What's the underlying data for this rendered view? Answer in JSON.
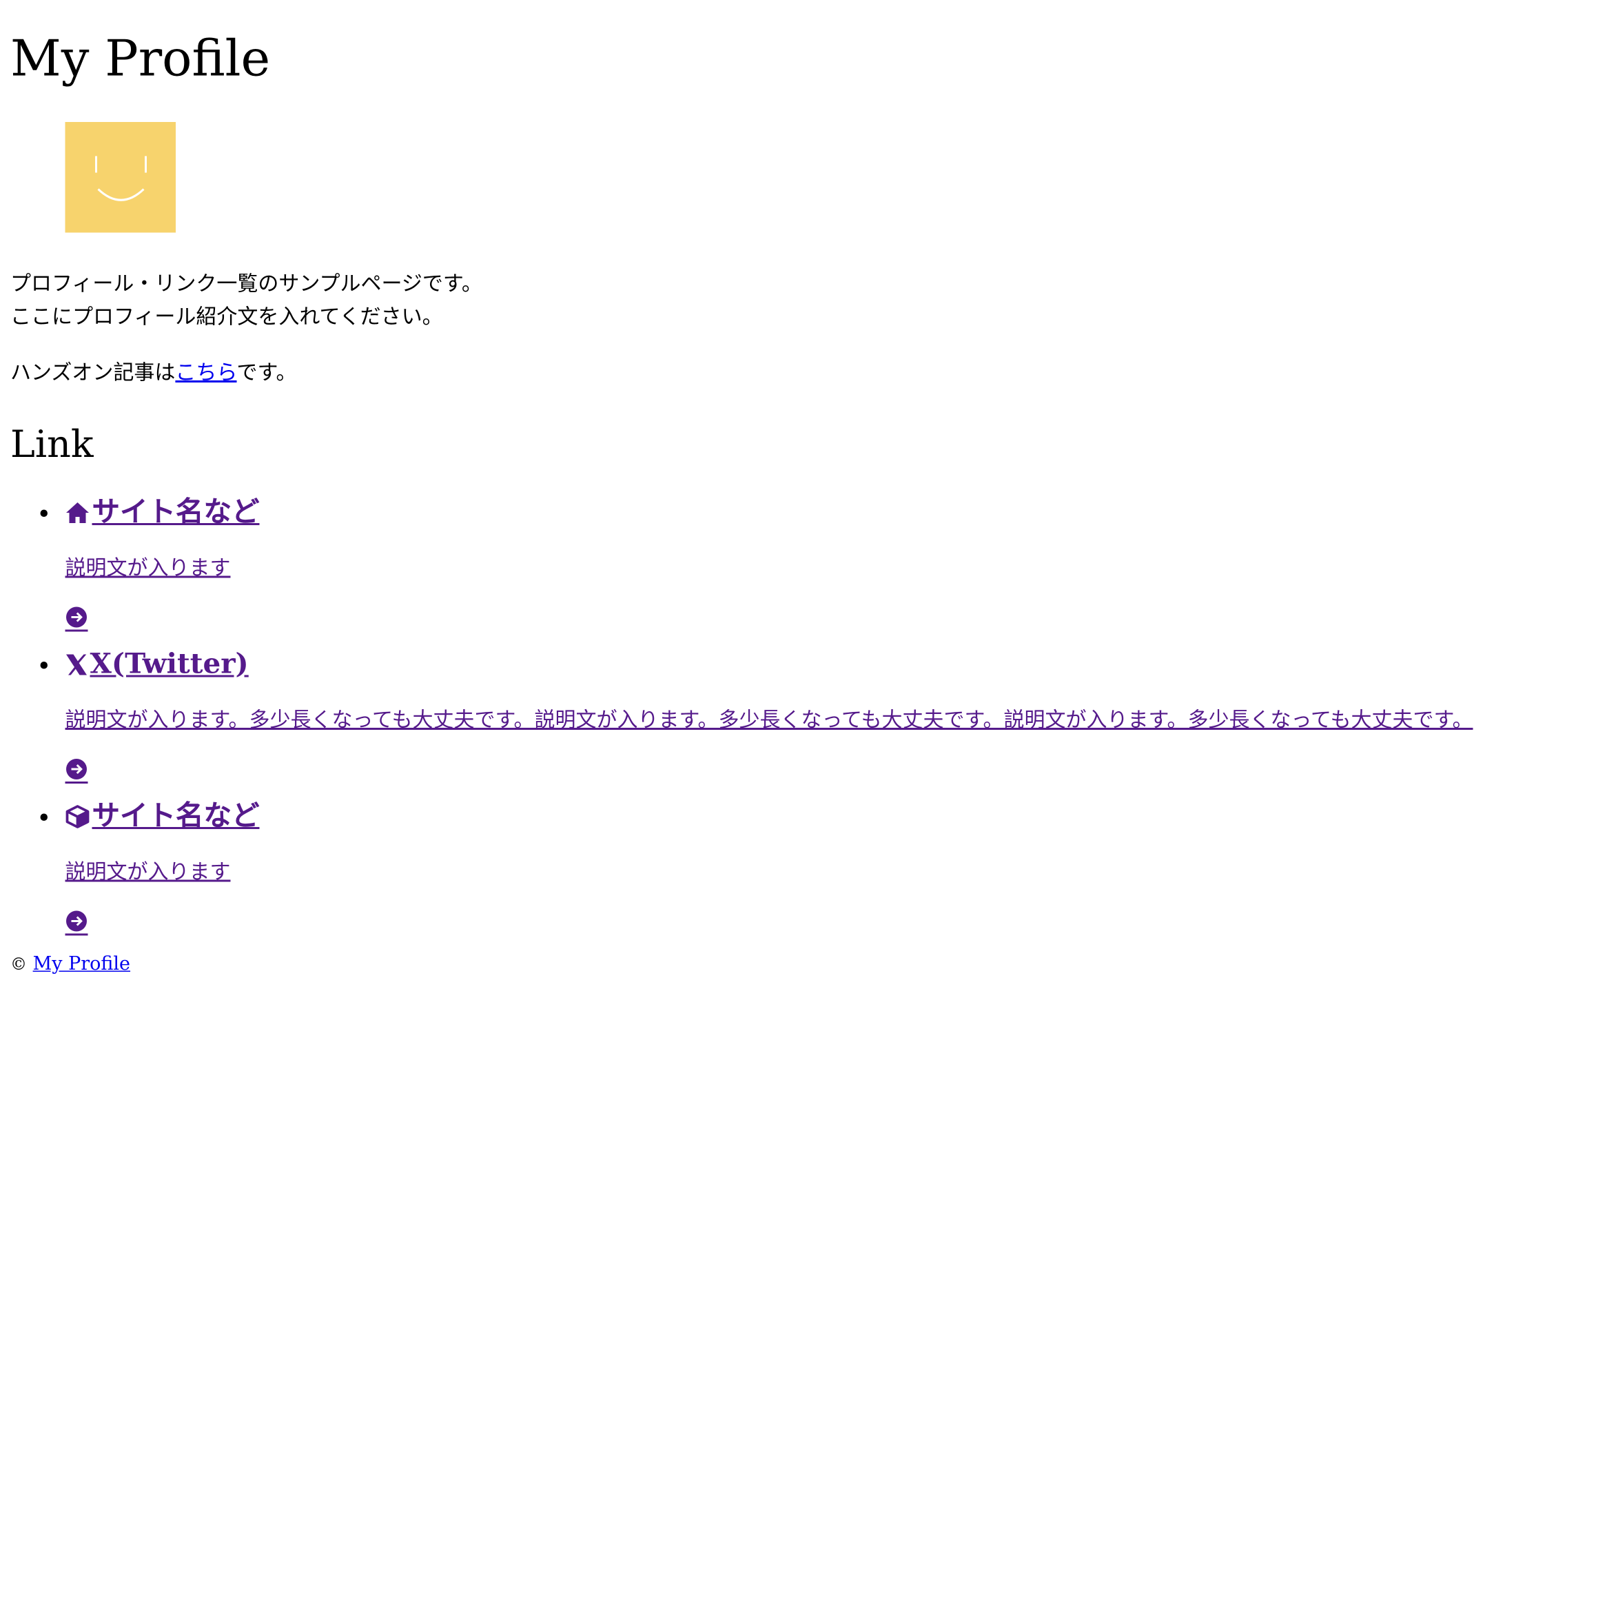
{
  "header": {
    "title": "My Profile"
  },
  "profile": {
    "intro_line1": "プロフィール・リンク一覧のサンプルページです。",
    "intro_line2": "ここにプロフィール紹介文を入れてください。",
    "handson_prefix": "ハンズオン記事は",
    "handson_link": "こちら",
    "handson_suffix": "です。"
  },
  "links_section": {
    "heading": "Link",
    "items": [
      {
        "icon": "home-icon",
        "title": "サイト名など",
        "description": "説明文が入ります"
      },
      {
        "icon": "x-logo-icon",
        "title": "X(Twitter)",
        "description": "説明文が入ります。多少長くなっても大丈夫です。説明文が入ります。多少長くなっても大丈夫です。説明文が入ります。多少長くなっても大丈夫です。"
      },
      {
        "icon": "cube-icon",
        "title": "サイト名など",
        "description": "説明文が入ります"
      }
    ]
  },
  "footer": {
    "copyright_symbol": "©",
    "link_text": "My Profile"
  },
  "colors": {
    "avatar_bg": "#f7d36d",
    "visited_link": "#551a8b",
    "link": "#0000ee"
  }
}
